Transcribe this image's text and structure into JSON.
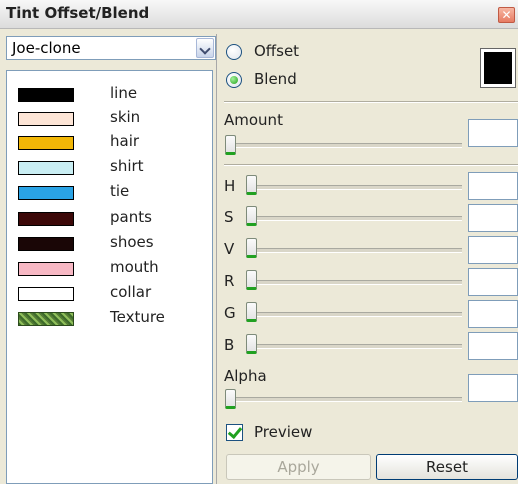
{
  "window": {
    "title": "Tint Offset/Blend",
    "close_glyph": "✕"
  },
  "character_select": {
    "selected": "Joe-clone"
  },
  "parts": [
    {
      "label": "line",
      "color": "#000000"
    },
    {
      "label": "skin",
      "color": "#fde5d6"
    },
    {
      "label": "hair",
      "color": "#f2b707"
    },
    {
      "label": "shirt",
      "color": "#c9eef3"
    },
    {
      "label": "tie",
      "color": "#2aa3e5"
    },
    {
      "label": "pants",
      "color": "#3c0808"
    },
    {
      "label": "shoes",
      "color": "#1a0606"
    },
    {
      "label": "mouth",
      "color": "#f7b8c4"
    },
    {
      "label": "collar",
      "color": "#ffffff"
    },
    {
      "label": "Texture",
      "color": "#55883a",
      "icon": "texture-icon"
    }
  ],
  "mode": {
    "offset_label": "Offset",
    "blend_label": "Blend",
    "selected": "Blend"
  },
  "tint_color": "#000000",
  "sliders": {
    "amount": {
      "label": "Amount",
      "value": ""
    },
    "h": {
      "label": "H",
      "value": ""
    },
    "s": {
      "label": "S",
      "value": ""
    },
    "v": {
      "label": "V",
      "value": ""
    },
    "r": {
      "label": "R",
      "value": ""
    },
    "g": {
      "label": "G",
      "value": ""
    },
    "b": {
      "label": "B",
      "value": ""
    },
    "alpha": {
      "label": "Alpha",
      "value": ""
    }
  },
  "preview": {
    "label": "Preview",
    "checked": true
  },
  "buttons": {
    "apply": "Apply",
    "reset": "Reset"
  }
}
